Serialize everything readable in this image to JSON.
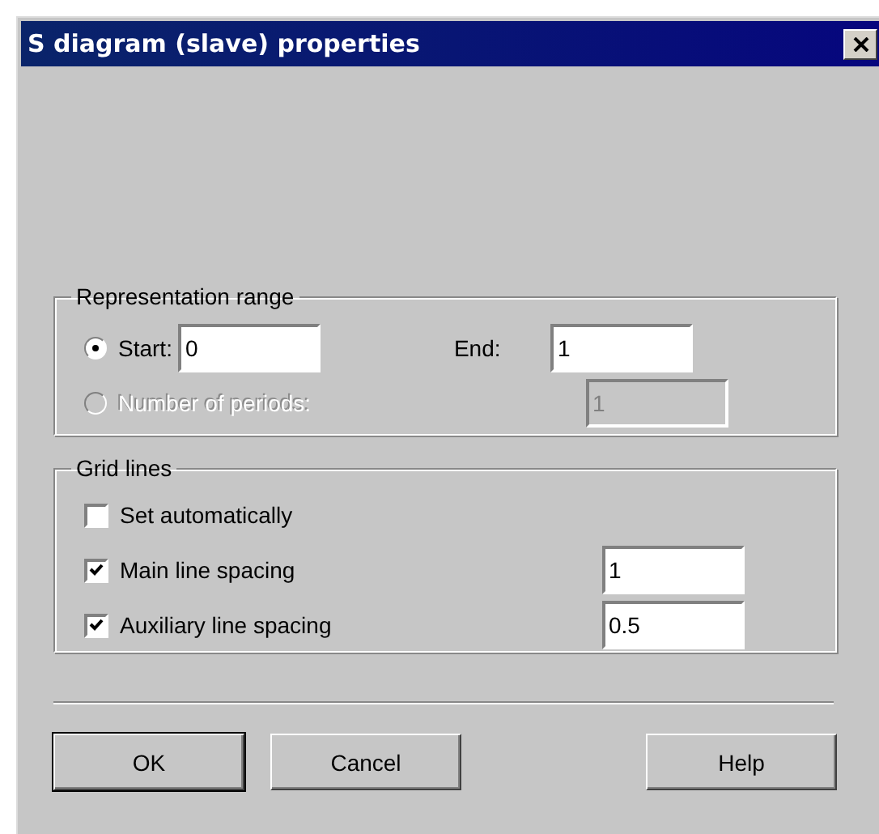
{
  "window": {
    "title": "S diagram (slave) properties"
  },
  "representation_range": {
    "title": "Representation range",
    "start": {
      "label": "Start:",
      "value": "0",
      "selected": true,
      "disabled": false
    },
    "end": {
      "label": "End:",
      "value": "1"
    },
    "periods": {
      "label": "Number of periods:",
      "value": "1",
      "selected": false,
      "disabled": true
    }
  },
  "grid_lines": {
    "title": "Grid lines",
    "items": [
      {
        "label": "Set automatically",
        "checked": false
      },
      {
        "label": "Main line spacing",
        "checked": true,
        "value": "1"
      },
      {
        "label": "Auxiliary line spacing",
        "checked": true,
        "value": "0.5"
      }
    ]
  },
  "buttons": [
    {
      "label": "OK",
      "default": true
    },
    {
      "label": "Cancel",
      "default": false
    },
    {
      "label": "Help",
      "default": false
    }
  ]
}
